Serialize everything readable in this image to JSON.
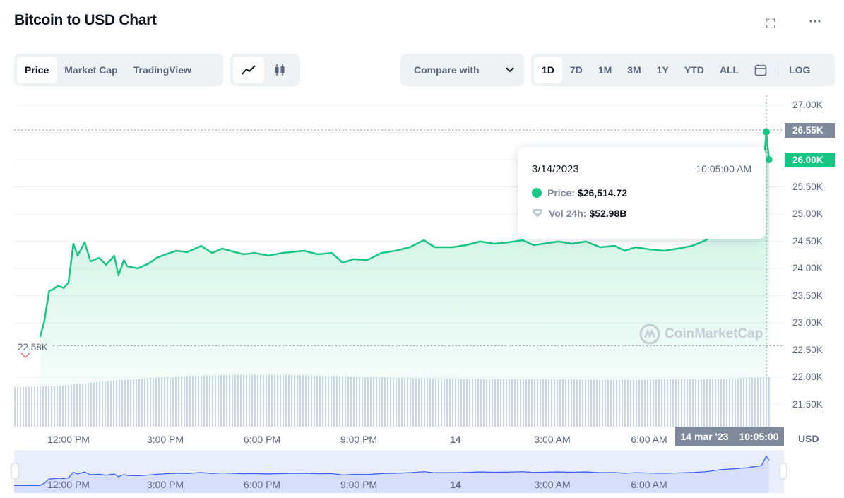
{
  "header": {
    "title": "Bitcoin to USD Chart",
    "fullscreen_icon": "expand-icon",
    "more_icon": "ellipsis-icon"
  },
  "tabs": [
    {
      "label": "Price",
      "active": true
    },
    {
      "label": "Market Cap"
    },
    {
      "label": "TradingView"
    }
  ],
  "chart_types": [
    {
      "icon": "line-chart-icon",
      "active": true
    },
    {
      "icon": "candlestick-icon"
    }
  ],
  "compare": {
    "label": "Compare with"
  },
  "ranges": [
    {
      "label": "1D",
      "active": true
    },
    {
      "label": "7D"
    },
    {
      "label": "1M"
    },
    {
      "label": "3M"
    },
    {
      "label": "1Y"
    },
    {
      "label": "YTD"
    },
    {
      "label": "ALL"
    }
  ],
  "log_label": "LOG",
  "tooltip": {
    "date": "3/14/2023",
    "time": "10:05:00 AM",
    "price_label": "Price:",
    "price": "$26,514.72",
    "vol_label": "Vol 24h:",
    "vol": "$52.98B"
  },
  "watermark": "CoinMarketCap",
  "colors": {
    "up": "#16c784",
    "down": "#ea3943",
    "navigator": "#3861fb",
    "volume": "#cfd6e4",
    "axis_box": "#808a9d"
  },
  "chart_data": {
    "type": "area",
    "currency": "USD",
    "ylim": [
      21400,
      27100
    ],
    "yticks": [
      "27.00K",
      "26.50K",
      "26.00K",
      "25.50K",
      "25.00K",
      "24.50K",
      "24.00K",
      "23.50K",
      "23.00K",
      "22.50K",
      "22.00K",
      "21.50K"
    ],
    "ytick_values": [
      27000,
      26500,
      26000,
      25500,
      25000,
      24500,
      24000,
      23500,
      23000,
      22500,
      22000,
      21500
    ],
    "current_price_label": "26.00K",
    "hover_price_label": "26.55K",
    "open_label": "22.58K",
    "open_value": 22580,
    "xticks": [
      "12:00 PM",
      "3:00 PM",
      "6:00 PM",
      "9:00 PM",
      "14",
      "3:00 AM",
      "6:00 AM"
    ],
    "xtick_times": [
      "2023-03-13 12:00",
      "2023-03-13 15:00",
      "2023-03-13 18:00",
      "2023-03-13 21:00",
      "2023-03-14 00:00",
      "2023-03-14 03:00",
      "2023-03-14 06:00"
    ],
    "hover_time_label": [
      "14 mar '23",
      "10:05:00"
    ],
    "grid": true,
    "points": [
      [
        "2023-03-13 11:07",
        22740
      ],
      [
        "2023-03-13 11:15",
        23030
      ],
      [
        "2023-03-13 11:24",
        23590
      ],
      [
        "2023-03-13 11:31",
        23610
      ],
      [
        "2023-03-13 11:40",
        23680
      ],
      [
        "2023-03-13 11:51",
        23640
      ],
      [
        "2023-03-13 12:00",
        23740
      ],
      [
        "2023-03-13 12:09",
        24455
      ],
      [
        "2023-03-13 12:17",
        24235
      ],
      [
        "2023-03-13 12:30",
        24480
      ],
      [
        "2023-03-13 12:41",
        24130
      ],
      [
        "2023-03-13 12:57",
        24195
      ],
      [
        "2023-03-13 13:10",
        24065
      ],
      [
        "2023-03-13 13:25",
        24235
      ],
      [
        "2023-03-13 13:33",
        23870
      ],
      [
        "2023-03-13 13:43",
        24155
      ],
      [
        "2023-03-13 13:49",
        24040
      ],
      [
        "2023-03-13 14:09",
        24000
      ],
      [
        "2023-03-13 14:29",
        24090
      ],
      [
        "2023-03-13 14:44",
        24195
      ],
      [
        "2023-03-13 15:01",
        24260
      ],
      [
        "2023-03-13 15:21",
        24325
      ],
      [
        "2023-03-13 15:41",
        24300
      ],
      [
        "2023-03-13 16:07",
        24415
      ],
      [
        "2023-03-13 16:27",
        24285
      ],
      [
        "2023-03-13 16:46",
        24365
      ],
      [
        "2023-03-13 17:06",
        24310
      ],
      [
        "2023-03-13 17:26",
        24260
      ],
      [
        "2023-03-13 17:46",
        24285
      ],
      [
        "2023-03-13 18:12",
        24235
      ],
      [
        "2023-03-13 18:38",
        24285
      ],
      [
        "2023-03-13 19:18",
        24325
      ],
      [
        "2023-03-13 19:44",
        24260
      ],
      [
        "2023-03-13 20:10",
        24285
      ],
      [
        "2023-03-13 20:30",
        24105
      ],
      [
        "2023-03-13 20:50",
        24170
      ],
      [
        "2023-03-13 21:16",
        24155
      ],
      [
        "2023-03-13 21:42",
        24285
      ],
      [
        "2023-03-13 22:08",
        24325
      ],
      [
        "2023-03-13 22:35",
        24390
      ],
      [
        "2023-03-13 23:01",
        24520
      ],
      [
        "2023-03-13 23:21",
        24390
      ],
      [
        "2023-03-13 23:54",
        24390
      ],
      [
        "2023-03-14 00:20",
        24430
      ],
      [
        "2023-03-14 00:46",
        24495
      ],
      [
        "2023-03-14 01:12",
        24455
      ],
      [
        "2023-03-14 01:39",
        24480
      ],
      [
        "2023-03-14 02:05",
        24520
      ],
      [
        "2023-03-14 02:25",
        24430
      ],
      [
        "2023-03-14 02:44",
        24455
      ],
      [
        "2023-03-14 03:11",
        24495
      ],
      [
        "2023-03-14 03:37",
        24455
      ],
      [
        "2023-03-14 04:03",
        24495
      ],
      [
        "2023-03-14 04:29",
        24390
      ],
      [
        "2023-03-14 04:56",
        24415
      ],
      [
        "2023-03-14 05:15",
        24325
      ],
      [
        "2023-03-14 05:35",
        24390
      ],
      [
        "2023-03-14 06:01",
        24350
      ],
      [
        "2023-03-14 06:28",
        24325
      ],
      [
        "2023-03-14 06:54",
        24365
      ],
      [
        "2023-03-14 07:20",
        24415
      ],
      [
        "2023-03-14 07:46",
        24520
      ],
      [
        "2023-03-14 08:13",
        24780
      ],
      [
        "2023-03-14 09:05",
        25040
      ],
      [
        "2023-03-14 09:29",
        25300
      ],
      [
        "2023-03-14 09:38",
        26510
      ],
      [
        "2023-03-14 09:43",
        26000
      ]
    ],
    "volume_profile": [
      0.7,
      0.72,
      0.8,
      0.86,
      0.9,
      0.92,
      0.92,
      0.9,
      0.88,
      0.86,
      0.85,
      0.84,
      0.84,
      0.83,
      0.83,
      0.84,
      0.85,
      0.88
    ]
  }
}
